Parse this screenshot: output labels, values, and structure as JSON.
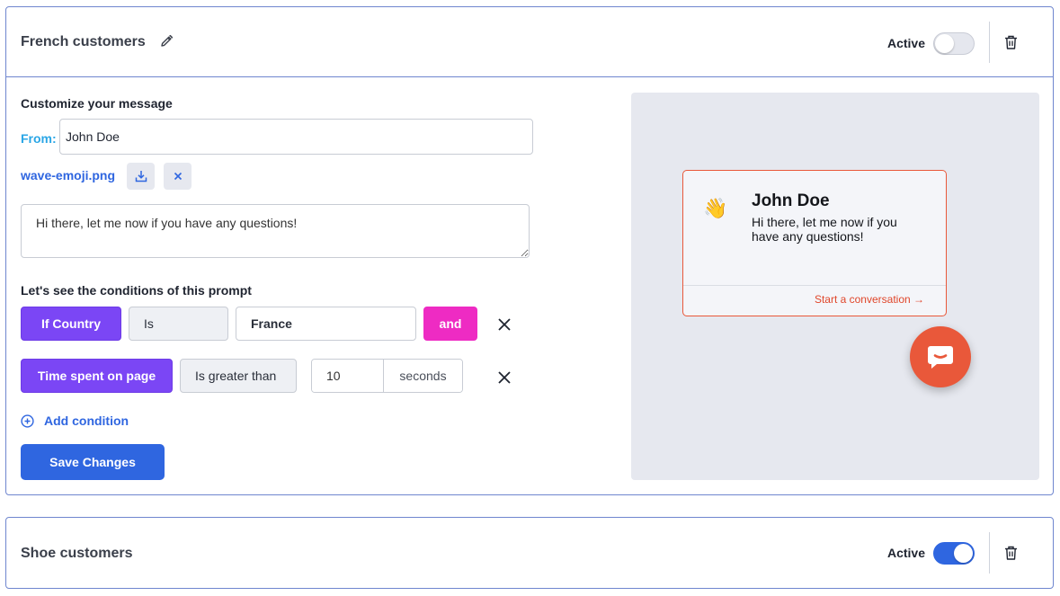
{
  "prompts": [
    {
      "title": "French customers",
      "active_label": "Active",
      "active": false
    },
    {
      "title": "Shoe customers",
      "active_label": "Active",
      "active": true
    }
  ],
  "editor": {
    "customize_heading": "Customize your message",
    "from_label": "From:",
    "from_value": "John Doe",
    "file_name": "wave-emoji.png",
    "message_value": "Hi there, let me now if you have any questions!",
    "conditions_heading": "Let's see the conditions of this prompt",
    "conditions": [
      {
        "field": "If Country",
        "operator": "Is",
        "value": "France",
        "connector": "and"
      },
      {
        "field": "Time spent on page",
        "operator": "Is greater than",
        "value": "10",
        "unit": "seconds"
      }
    ],
    "add_condition_label": "Add condition",
    "save_label": "Save Changes"
  },
  "preview": {
    "emoji": "👋",
    "name": "John Doe",
    "message": "Hi there, let me now if you have any questions!",
    "cta": "Start a conversation →"
  },
  "colors": {
    "primary": "#2f66e0",
    "purple": "#7b46f5",
    "pink": "#ee2bc3",
    "accent_orange": "#e9583a",
    "from_label": "#2aa6e6"
  },
  "icons": {
    "edit": "pencil-icon",
    "delete": "trash-icon",
    "download": "download-icon",
    "remove_file": "close-icon",
    "remove_condition": "close-icon",
    "add": "plus-circle-icon",
    "launcher": "chat-icon"
  }
}
